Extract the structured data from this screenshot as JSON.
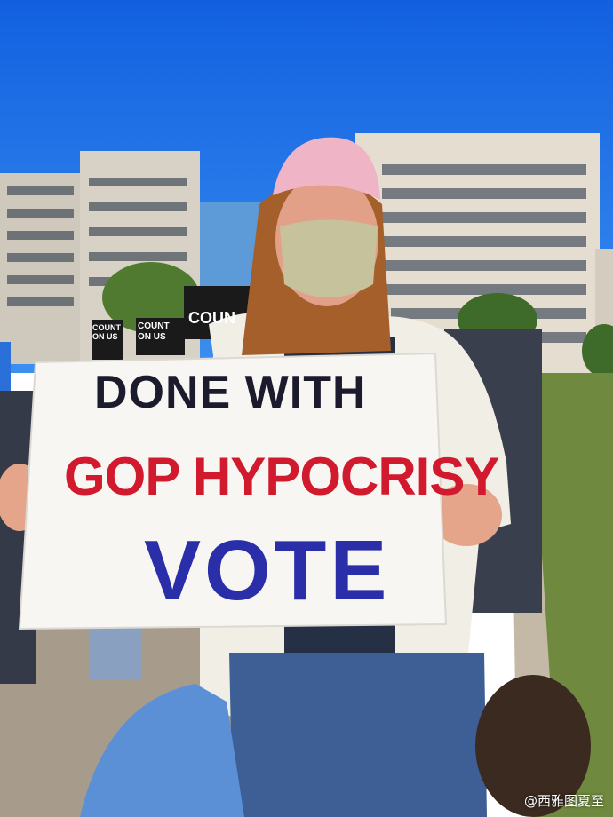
{
  "sign": {
    "line1": "DONE WITH",
    "line2": "GOP HYPOCRISY",
    "line3": "VOTE"
  },
  "background_signs": {
    "count_large": "COUN",
    "count_on_us_a": "COUNT ON US",
    "count_on_us_b": "COUNT ON US"
  },
  "watermark": "@西雅图夏至",
  "colors": {
    "sky": "#1e73e6",
    "sign_black": "#1c1b2e",
    "sign_red": "#d11a2e",
    "sign_blue": "#2a2ea8"
  }
}
